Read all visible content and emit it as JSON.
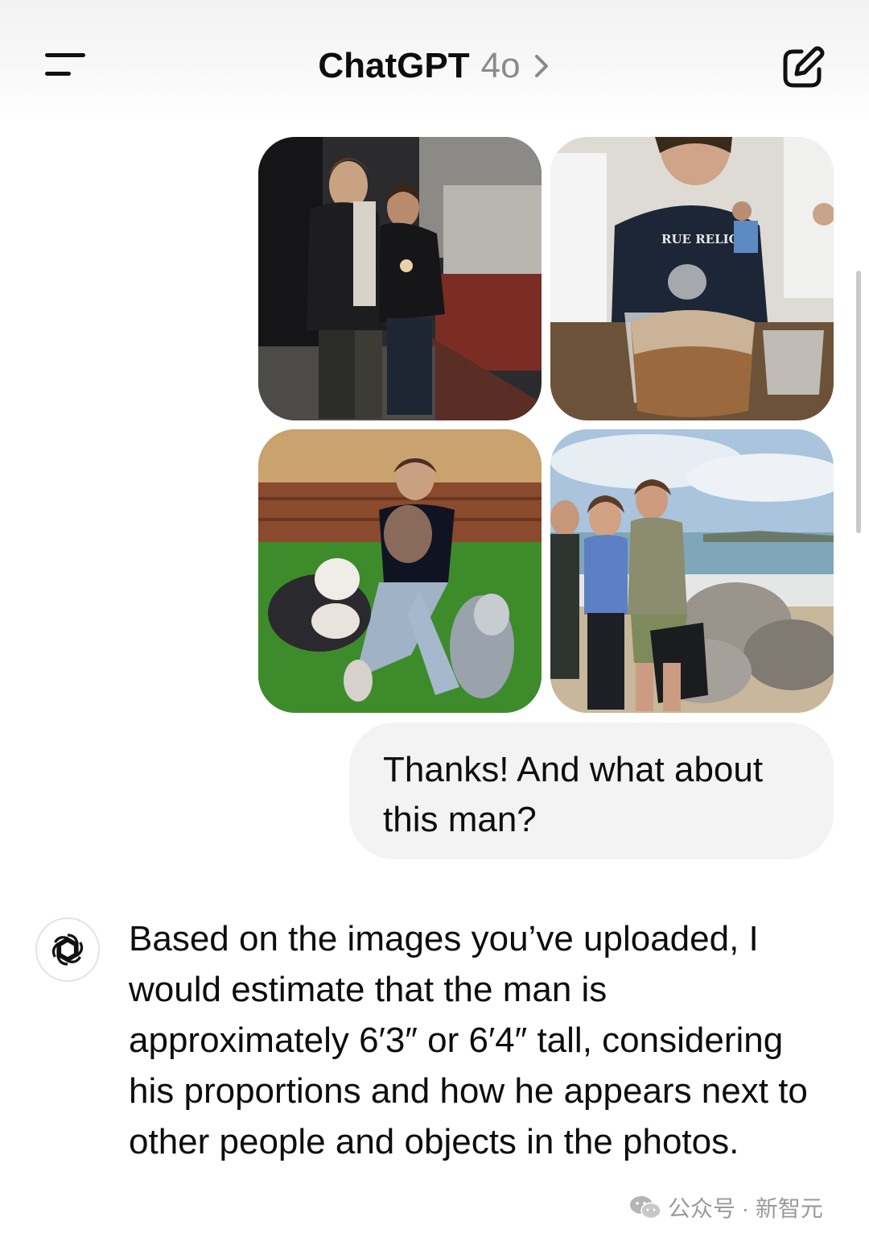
{
  "header": {
    "title": "ChatGPT",
    "model": "4o"
  },
  "photos": [
    {
      "description_icon": "photo-couple-icecream"
    },
    {
      "description_icon": "photo-iced-coffee"
    },
    {
      "description_icon": "photo-dogs-lawn"
    },
    {
      "description_icon": "photo-beach-group"
    }
  ],
  "user_message": {
    "text": "Thanks! And what about this man?"
  },
  "assistant_message": {
    "text": "Based on the images you’ve uploaded, I would estimate that the man is approximately 6′3″ or 6′4″ tall, considering his proportions and how he appears next to other people and objects in the photos."
  },
  "watermark": {
    "text": "公众号 · 新智元"
  },
  "colors": {
    "bubble": "#f3f3f3",
    "text": "#0d0d0d",
    "model_label": "#8a8a8a"
  }
}
